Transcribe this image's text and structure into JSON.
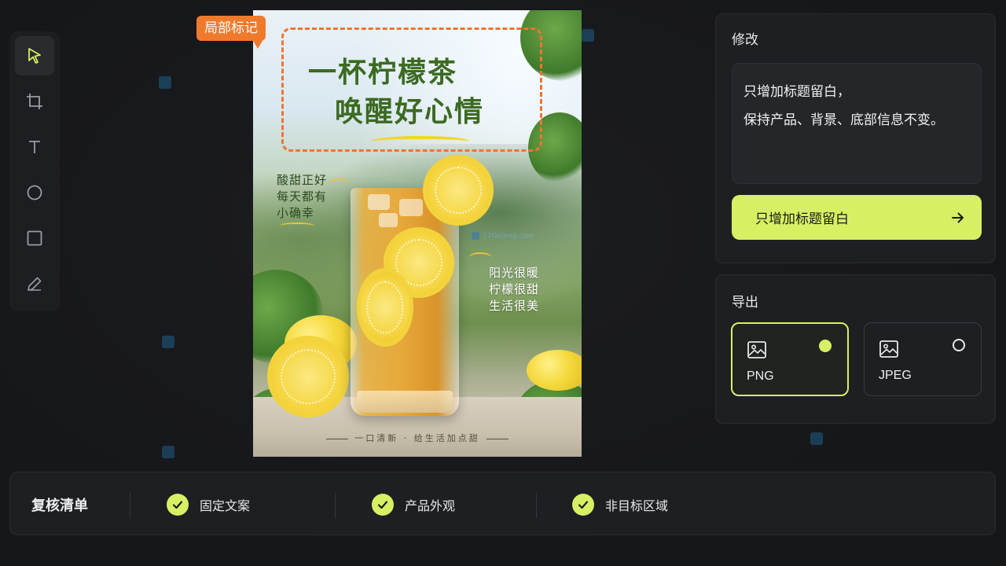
{
  "toolbar": {
    "tools": [
      {
        "name": "select-tool",
        "icon": "cursor-arrow-icon",
        "active": true
      },
      {
        "name": "crop-tool",
        "icon": "crop-icon"
      },
      {
        "name": "text-tool",
        "icon": "text-t-icon"
      },
      {
        "name": "ellipse-tool",
        "icon": "circle-icon"
      },
      {
        "name": "rectangle-tool",
        "icon": "square-icon"
      },
      {
        "name": "pen-tool",
        "icon": "pencil-icon"
      }
    ],
    "accent_color": "#d6f064"
  },
  "canvas": {
    "tag_label": "局部标记",
    "overlay_watermark": "17Golang.com",
    "poster": {
      "title_line1": "一杯柠檬茶",
      "title_line2": "唤醒好心情",
      "left_text": [
        "酸甜正好",
        "每天都有",
        "小确幸"
      ],
      "right_text": [
        "阳光很暖",
        "柠檬很甜",
        "生活很美"
      ],
      "footer": "一口清新 · 给生活加点甜"
    }
  },
  "edit_panel": {
    "title": "修改",
    "instruction_lines": [
      "只增加标题留白，",
      "保持产品、背景、底部信息不变。"
    ],
    "apply_button": "只增加标题留白",
    "apply_icon": "arrow-right-icon"
  },
  "export_panel": {
    "title": "导出",
    "formats": [
      {
        "label": "PNG",
        "selected": true,
        "icon": "image-icon"
      },
      {
        "label": "JPEG",
        "selected": false,
        "icon": "image-icon"
      }
    ]
  },
  "checklist": {
    "title": "复核清单",
    "items": [
      {
        "label": "固定文案",
        "checked": true
      },
      {
        "label": "产品外观",
        "checked": true
      },
      {
        "label": "非目标区域",
        "checked": true
      }
    ]
  }
}
